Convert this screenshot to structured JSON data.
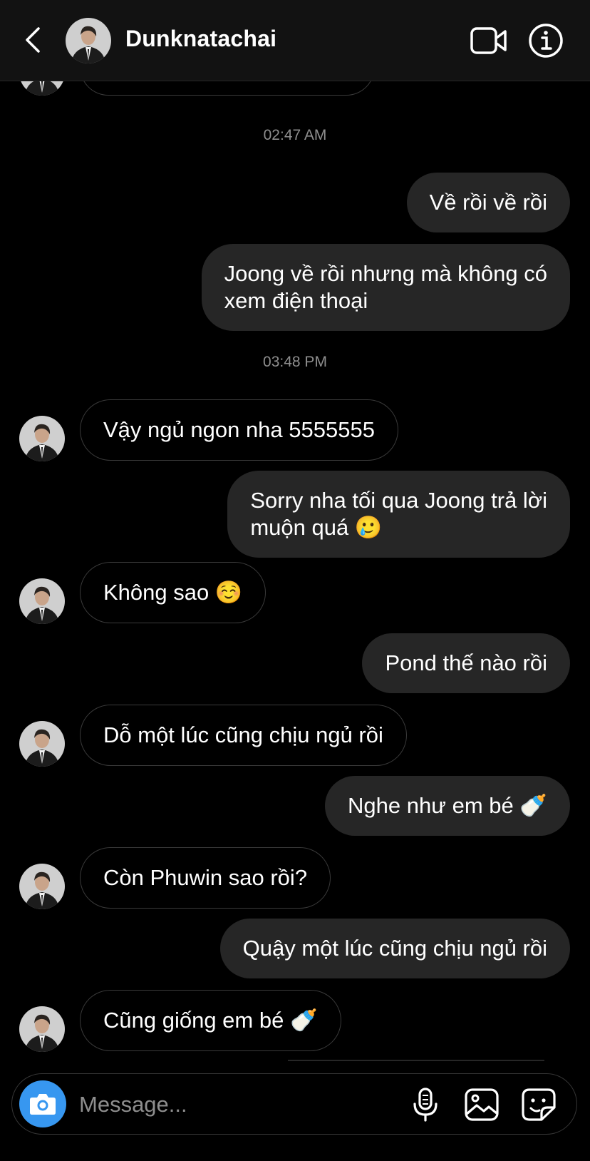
{
  "header": {
    "contact_name": "Dunknatachai"
  },
  "chat": {
    "timestamps": [
      "02:47 AM",
      "03:48 PM"
    ],
    "messages": [
      {
        "side": "out",
        "text": "Về rồi về rồi"
      },
      {
        "side": "out",
        "text": "Joong về rồi nhưng mà không có\nxem điện thoại"
      },
      {
        "side": "in",
        "text": "Vậy ngủ ngon nha 5555555"
      },
      {
        "side": "out",
        "text": "Sorry nha tối qua Joong trả lời\nmuộn quá 🥲"
      },
      {
        "side": "in",
        "text": "Không sao ☺️"
      },
      {
        "side": "out",
        "text": "Pond thế nào rồi"
      },
      {
        "side": "in",
        "text": "Dỗ một lúc cũng chịu ngủ rồi"
      },
      {
        "side": "out",
        "text": "Nghe như em bé 🍼"
      },
      {
        "side": "in",
        "text": "Còn Phuwin sao rồi?"
      },
      {
        "side": "out",
        "text": "Quậy một lúc cũng chịu ngủ rồi"
      },
      {
        "side": "in",
        "text": "Cũng giống em bé 🍼"
      }
    ]
  },
  "composer": {
    "placeholder": "Message..."
  },
  "colors": {
    "background": "#000000",
    "header_bg": "#121212",
    "outgoing_bubble": "#262626",
    "incoming_border": "#3a3a3a",
    "camera_button": "#3797f0",
    "muted_text": "#8e8e8e"
  },
  "icons": [
    "back-chevron-icon",
    "video-call-icon",
    "info-icon",
    "camera-icon",
    "microphone-icon",
    "gallery-icon",
    "sticker-icon"
  ]
}
